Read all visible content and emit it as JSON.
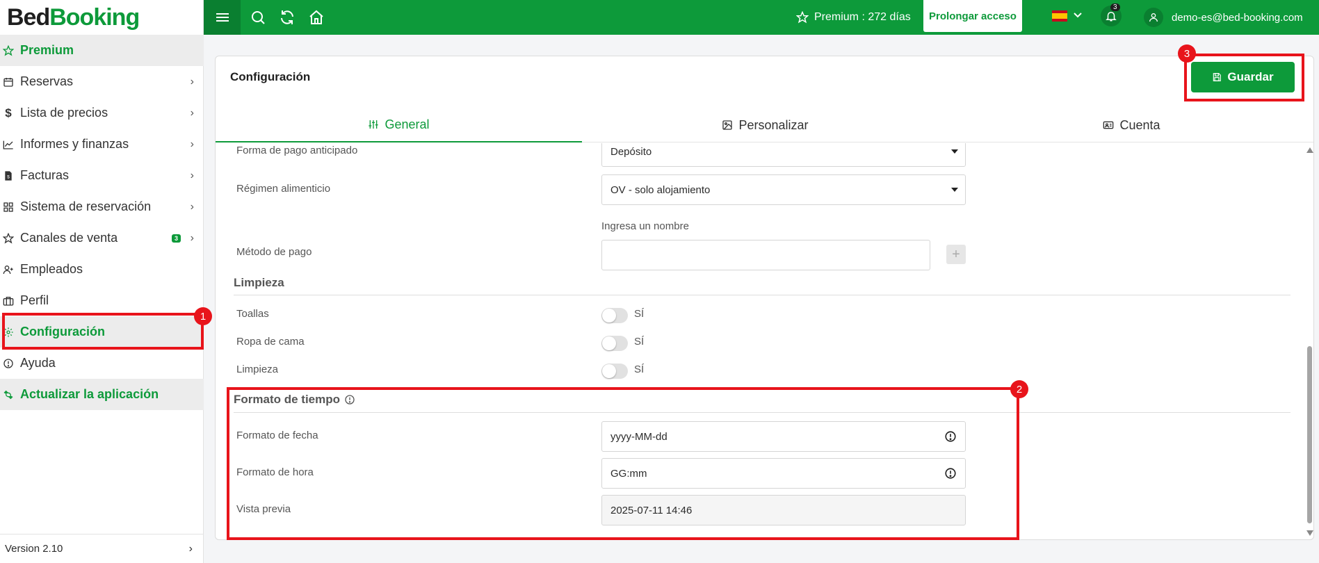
{
  "logo": {
    "part1": "Bed",
    "part2": "Booking"
  },
  "sidebar": {
    "items": [
      {
        "label": "Premium"
      },
      {
        "label": "Reservas"
      },
      {
        "label": "Lista de precios"
      },
      {
        "label": "Informes y finanzas"
      },
      {
        "label": "Facturas"
      },
      {
        "label": "Sistema de reservación"
      },
      {
        "label": "Canales de venta",
        "badge": "3"
      },
      {
        "label": "Empleados"
      },
      {
        "label": "Perfil"
      },
      {
        "label": "Configuración"
      },
      {
        "label": "Ayuda"
      },
      {
        "label": "Actualizar la aplicación"
      }
    ],
    "version": "Version 2.10"
  },
  "topbar": {
    "premium": "Premium : 272 días",
    "prolong_label": "Prolongar acceso",
    "notifications_count": "3",
    "user_email": "demo-es@bed-booking.com"
  },
  "card": {
    "title": "Configuración",
    "save_label": "Guardar",
    "tabs": [
      {
        "label": "General"
      },
      {
        "label": "Personalizar"
      },
      {
        "label": "Cuenta"
      }
    ]
  },
  "form": {
    "payment_advance": {
      "label": "Forma de pago anticipado",
      "value": "Depósito"
    },
    "meal_plan": {
      "label": "Régimen alimenticio",
      "value": "OV - solo alojamiento"
    },
    "payment_method": {
      "label": "Método de pago",
      "hint": "Ingresa un nombre",
      "value": ""
    },
    "cleaning": {
      "heading": "Limpieza",
      "items": [
        {
          "label": "Toallas",
          "state": "SÍ"
        },
        {
          "label": "Ropa de cama",
          "state": "SÍ"
        },
        {
          "label": "Limpieza",
          "state": "SÍ"
        }
      ]
    },
    "time_format": {
      "heading": "Formato de tiempo",
      "date_label": "Formato de fecha",
      "date_value": "yyyy-MM-dd",
      "time_label": "Formato de hora",
      "time_value": "GG:mm",
      "preview_label": "Vista previa",
      "preview_value": "2025-07-11 14:46"
    }
  },
  "annotations": [
    "1",
    "2",
    "3"
  ]
}
